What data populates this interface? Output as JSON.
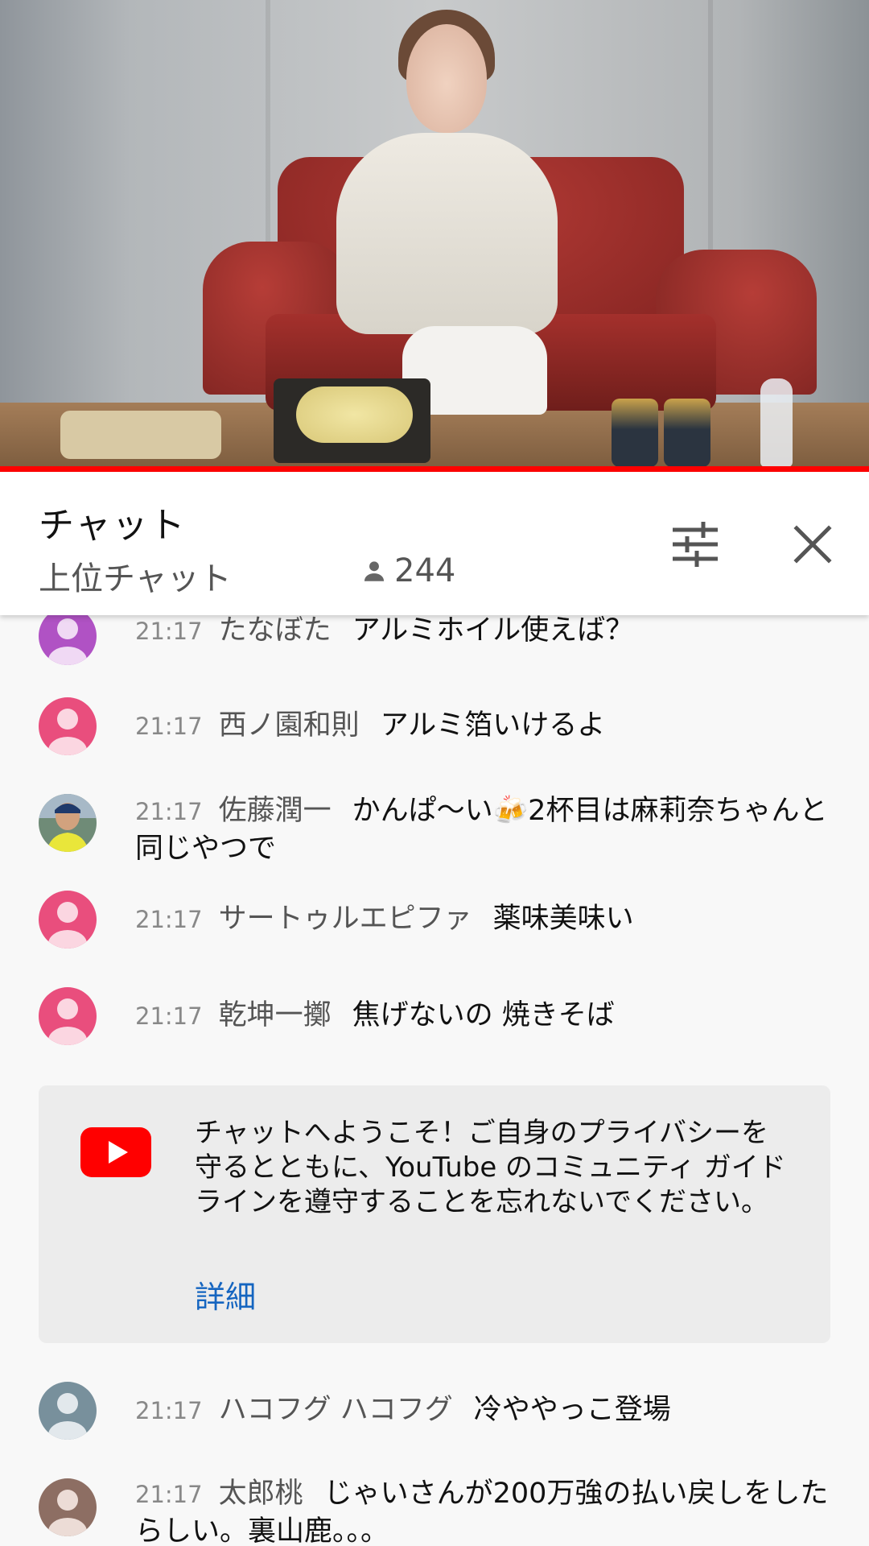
{
  "chat": {
    "title": "チャット",
    "mode": "上位チャット",
    "viewer_count": "244"
  },
  "messages_top": [
    {
      "time": "21:17",
      "author": "たなぼた",
      "text": "アルミホイル使えば？",
      "avatar": "purple-default-avatar",
      "avatar_color": "#b052c4"
    },
    {
      "time": "21:17",
      "author": "西ノ園和則",
      "text": "アルミ箔いけるよ",
      "avatar": "pink-default-avatar",
      "avatar_color": "#e94e7d"
    },
    {
      "time": "21:17",
      "author": "佐藤潤一",
      "text": "かんぱ〜い🍻2杯目は麻莉奈ちゃんと同じやつで",
      "avatar": "photo-avatar",
      "avatar_color": "#3f5a7a"
    },
    {
      "time": "21:17",
      "author": "サートゥルエピファ",
      "text": "薬味美味い",
      "avatar": "pink-default-avatar",
      "avatar_color": "#e94e7d"
    },
    {
      "time": "21:17",
      "author": "乾坤一擲",
      "text": "焦げないの 焼きそば",
      "avatar": "pink-default-avatar",
      "avatar_color": "#e94e7d"
    }
  ],
  "welcome": {
    "text": "チャットへようこそ！ご自身のプライバシーを守るとともに、YouTube のコミュニティ ガイドラインを遵守することを忘れないでください。",
    "link": "詳細"
  },
  "messages_bottom": [
    {
      "time": "21:17",
      "author": "ハコフグ ハコフグ",
      "text": "冷ややっこ登場",
      "avatar": "gray-default-avatar",
      "avatar_color": "#78909c"
    },
    {
      "time": "21:17",
      "author": "太郎桃",
      "text": "じゃいさんが200万強の払い戻しをしたらしい。裏山鹿。。。",
      "avatar": "brown-default-avatar",
      "avatar_color": "#8d6e63"
    }
  ],
  "colors": {
    "progress": "#ff0000",
    "link": "#1565c0",
    "youtube_red": "#ff0000"
  }
}
